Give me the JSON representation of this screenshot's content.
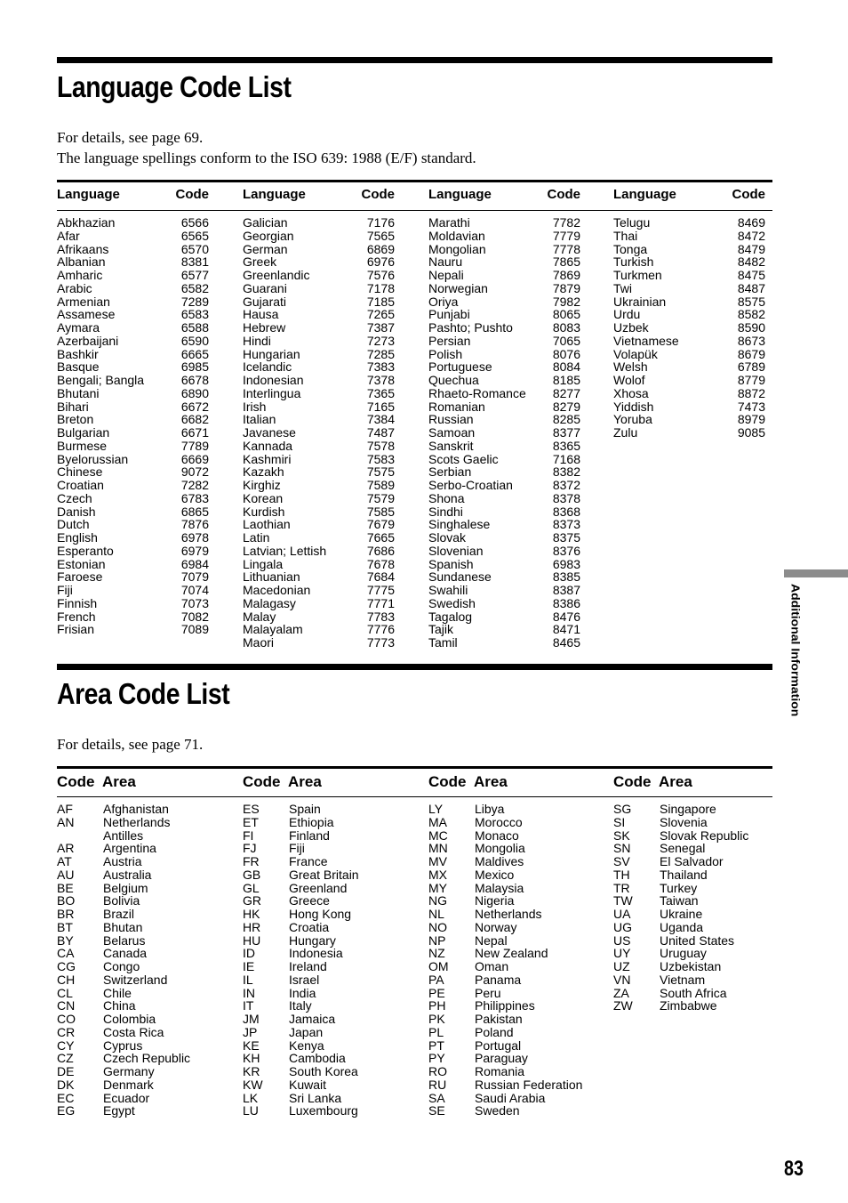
{
  "language_section": {
    "title": "Language Code List",
    "intro_line1": "For details, see page 69.",
    "intro_line2": "The language spellings conform to the ISO 639: 1988 (E/F) standard.",
    "header_language": "Language",
    "header_code": "Code",
    "columns": [
      [
        [
          "Abkhazian",
          "6566"
        ],
        [
          "Afar",
          "6565"
        ],
        [
          "Afrikaans",
          "6570"
        ],
        [
          "Albanian",
          "8381"
        ],
        [
          "Amharic",
          "6577"
        ],
        [
          "Arabic",
          "6582"
        ],
        [
          "Armenian",
          "7289"
        ],
        [
          "Assamese",
          "6583"
        ],
        [
          "Aymara",
          "6588"
        ],
        [
          "Azerbaijani",
          "6590"
        ],
        [
          "Bashkir",
          "6665"
        ],
        [
          "Basque",
          "6985"
        ],
        [
          "Bengali; Bangla",
          "6678"
        ],
        [
          "Bhutani",
          "6890"
        ],
        [
          "Bihari",
          "6672"
        ],
        [
          "Breton",
          "6682"
        ],
        [
          "Bulgarian",
          "6671"
        ],
        [
          "Burmese",
          "7789"
        ],
        [
          "Byelorussian",
          "6669"
        ],
        [
          "Chinese",
          "9072"
        ],
        [
          "Croatian",
          "7282"
        ],
        [
          "Czech",
          "6783"
        ],
        [
          "Danish",
          "6865"
        ],
        [
          "Dutch",
          "7876"
        ],
        [
          "English",
          "6978"
        ],
        [
          "Esperanto",
          "6979"
        ],
        [
          "Estonian",
          "6984"
        ],
        [
          "Faroese",
          "7079"
        ],
        [
          "Fiji",
          "7074"
        ],
        [
          "Finnish",
          "7073"
        ],
        [
          "French",
          "7082"
        ],
        [
          "Frisian",
          "7089"
        ]
      ],
      [
        [
          "Galician",
          "7176"
        ],
        [
          "Georgian",
          "7565"
        ],
        [
          "German",
          "6869"
        ],
        [
          "Greek",
          "6976"
        ],
        [
          "Greenlandic",
          "7576"
        ],
        [
          "Guarani",
          "7178"
        ],
        [
          "Gujarati",
          "7185"
        ],
        [
          "Hausa",
          "7265"
        ],
        [
          "Hebrew",
          "7387"
        ],
        [
          "Hindi",
          "7273"
        ],
        [
          "Hungarian",
          "7285"
        ],
        [
          "Icelandic",
          "7383"
        ],
        [
          "Indonesian",
          "7378"
        ],
        [
          "Interlingua",
          "7365"
        ],
        [
          "Irish",
          "7165"
        ],
        [
          "Italian",
          "7384"
        ],
        [
          "Javanese",
          "7487"
        ],
        [
          "Kannada",
          "7578"
        ],
        [
          "Kashmiri",
          "7583"
        ],
        [
          "Kazakh",
          "7575"
        ],
        [
          "Kirghiz",
          "7589"
        ],
        [
          "Korean",
          "7579"
        ],
        [
          "Kurdish",
          "7585"
        ],
        [
          "Laothian",
          "7679"
        ],
        [
          "Latin",
          "7665"
        ],
        [
          "Latvian; Lettish",
          "7686"
        ],
        [
          "Lingala",
          "7678"
        ],
        [
          "Lithuanian",
          "7684"
        ],
        [
          "Macedonian",
          "7775"
        ],
        [
          "Malagasy",
          "7771"
        ],
        [
          "Malay",
          "7783"
        ],
        [
          "Malayalam",
          "7776"
        ],
        [
          "Maori",
          "7773"
        ]
      ],
      [
        [
          "Marathi",
          "7782"
        ],
        [
          "Moldavian",
          "7779"
        ],
        [
          "Mongolian",
          "7778"
        ],
        [
          "Nauru",
          "7865"
        ],
        [
          "Nepali",
          "7869"
        ],
        [
          "Norwegian",
          "7879"
        ],
        [
          "Oriya",
          "7982"
        ],
        [
          "Punjabi",
          "8065"
        ],
        [
          "Pashto; Pushto",
          "8083"
        ],
        [
          "Persian",
          "7065"
        ],
        [
          "Polish",
          "8076"
        ],
        [
          "Portuguese",
          "8084"
        ],
        [
          "Quechua",
          "8185"
        ],
        [
          "Rhaeto-Romance",
          "8277"
        ],
        [
          "Romanian",
          "8279"
        ],
        [
          "Russian",
          "8285"
        ],
        [
          "Samoan",
          "8377"
        ],
        [
          "Sanskrit",
          "8365"
        ],
        [
          "Scots Gaelic",
          "7168"
        ],
        [
          "Serbian",
          "8382"
        ],
        [
          "Serbo-Croatian",
          "8372"
        ],
        [
          "Shona",
          "8378"
        ],
        [
          "Sindhi",
          "8368"
        ],
        [
          "Singhalese",
          "8373"
        ],
        [
          "Slovak",
          "8375"
        ],
        [
          "Slovenian",
          "8376"
        ],
        [
          "Spanish",
          "6983"
        ],
        [
          "Sundanese",
          "8385"
        ],
        [
          "Swahili",
          "8387"
        ],
        [
          "Swedish",
          "8386"
        ],
        [
          "Tagalog",
          "8476"
        ],
        [
          "Tajik",
          "8471"
        ],
        [
          "Tamil",
          "8465"
        ]
      ],
      [
        [
          "Telugu",
          "8469"
        ],
        [
          "Thai",
          "8472"
        ],
        [
          "Tonga",
          "8479"
        ],
        [
          "Turkish",
          "8482"
        ],
        [
          "Turkmen",
          "8475"
        ],
        [
          "Twi",
          "8487"
        ],
        [
          "Ukrainian",
          "8575"
        ],
        [
          "Urdu",
          "8582"
        ],
        [
          "Uzbek",
          "8590"
        ],
        [
          "Vietnamese",
          "8673"
        ],
        [
          "Volapük",
          "8679"
        ],
        [
          "Welsh",
          "6789"
        ],
        [
          "Wolof",
          "8779"
        ],
        [
          "Xhosa",
          "8872"
        ],
        [
          "Yiddish",
          "7473"
        ],
        [
          "Yoruba",
          "8979"
        ],
        [
          "Zulu",
          "9085"
        ]
      ]
    ]
  },
  "area_section": {
    "title": "Area Code List",
    "intro_line1": "For details, see page 71.",
    "header_code": "Code",
    "header_area": "Area",
    "columns": [
      [
        [
          "AF",
          "Afghanistan"
        ],
        [
          "AN",
          "Netherlands"
        ],
        [
          "",
          "Antilles"
        ],
        [
          "AR",
          "Argentina"
        ],
        [
          "AT",
          "Austria"
        ],
        [
          "AU",
          "Australia"
        ],
        [
          "BE",
          "Belgium"
        ],
        [
          "BO",
          "Bolivia"
        ],
        [
          "BR",
          "Brazil"
        ],
        [
          "BT",
          "Bhutan"
        ],
        [
          "BY",
          "Belarus"
        ],
        [
          "CA",
          "Canada"
        ],
        [
          "CG",
          "Congo"
        ],
        [
          "CH",
          "Switzerland"
        ],
        [
          "CL",
          "Chile"
        ],
        [
          "CN",
          "China"
        ],
        [
          "CO",
          "Colombia"
        ],
        [
          "CR",
          "Costa Rica"
        ],
        [
          "CY",
          "Cyprus"
        ],
        [
          "CZ",
          "Czech Republic"
        ],
        [
          "DE",
          "Germany"
        ],
        [
          "DK",
          "Denmark"
        ],
        [
          "EC",
          "Ecuador"
        ],
        [
          "EG",
          "Egypt"
        ]
      ],
      [
        [
          "ES",
          "Spain"
        ],
        [
          "ET",
          "Ethiopia"
        ],
        [
          "FI",
          "Finland"
        ],
        [
          "FJ",
          "Fiji"
        ],
        [
          "FR",
          "France"
        ],
        [
          "GB",
          "Great Britain"
        ],
        [
          "GL",
          "Greenland"
        ],
        [
          "GR",
          "Greece"
        ],
        [
          "HK",
          "Hong Kong"
        ],
        [
          "HR",
          "Croatia"
        ],
        [
          "HU",
          "Hungary"
        ],
        [
          "ID",
          "Indonesia"
        ],
        [
          "IE",
          "Ireland"
        ],
        [
          "IL",
          "Israel"
        ],
        [
          "IN",
          "India"
        ],
        [
          "IT",
          "Italy"
        ],
        [
          "JM",
          "Jamaica"
        ],
        [
          "JP",
          "Japan"
        ],
        [
          "KE",
          "Kenya"
        ],
        [
          "KH",
          "Cambodia"
        ],
        [
          "KR",
          "South Korea"
        ],
        [
          "KW",
          "Kuwait"
        ],
        [
          "LK",
          "Sri Lanka"
        ],
        [
          "LU",
          "Luxembourg"
        ]
      ],
      [
        [
          "LY",
          "Libya"
        ],
        [
          "MA",
          "Morocco"
        ],
        [
          "MC",
          "Monaco"
        ],
        [
          "MN",
          "Mongolia"
        ],
        [
          "MV",
          "Maldives"
        ],
        [
          "MX",
          "Mexico"
        ],
        [
          "MY",
          "Malaysia"
        ],
        [
          "NG",
          "Nigeria"
        ],
        [
          "NL",
          "Netherlands"
        ],
        [
          "NO",
          "Norway"
        ],
        [
          "NP",
          "Nepal"
        ],
        [
          "NZ",
          "New Zealand"
        ],
        [
          "OM",
          "Oman"
        ],
        [
          "PA",
          "Panama"
        ],
        [
          "PE",
          "Peru"
        ],
        [
          "PH",
          "Philippines"
        ],
        [
          "PK",
          "Pakistan"
        ],
        [
          "PL",
          "Poland"
        ],
        [
          "PT",
          "Portugal"
        ],
        [
          "PY",
          "Paraguay"
        ],
        [
          "RO",
          "Romania"
        ],
        [
          "RU",
          "Russian Federation"
        ],
        [
          "SA",
          "Saudi Arabia"
        ],
        [
          "SE",
          "Sweden"
        ]
      ],
      [
        [
          "SG",
          "Singapore"
        ],
        [
          "SI",
          "Slovenia"
        ],
        [
          "SK",
          "Slovak Republic"
        ],
        [
          "SN",
          "Senegal"
        ],
        [
          "SV",
          "El Salvador"
        ],
        [
          "TH",
          "Thailand"
        ],
        [
          "TR",
          "Turkey"
        ],
        [
          "TW",
          "Taiwan"
        ],
        [
          "UA",
          "Ukraine"
        ],
        [
          "UG",
          "Uganda"
        ],
        [
          "US",
          "United States"
        ],
        [
          "UY",
          "Uruguay"
        ],
        [
          "UZ",
          "Uzbekistan"
        ],
        [
          "VN",
          "Vietnam"
        ],
        [
          "ZA",
          "South Africa"
        ],
        [
          "ZW",
          "Zimbabwe"
        ]
      ]
    ]
  },
  "side_tab": {
    "label": "Additional Information"
  },
  "page_number": "83"
}
